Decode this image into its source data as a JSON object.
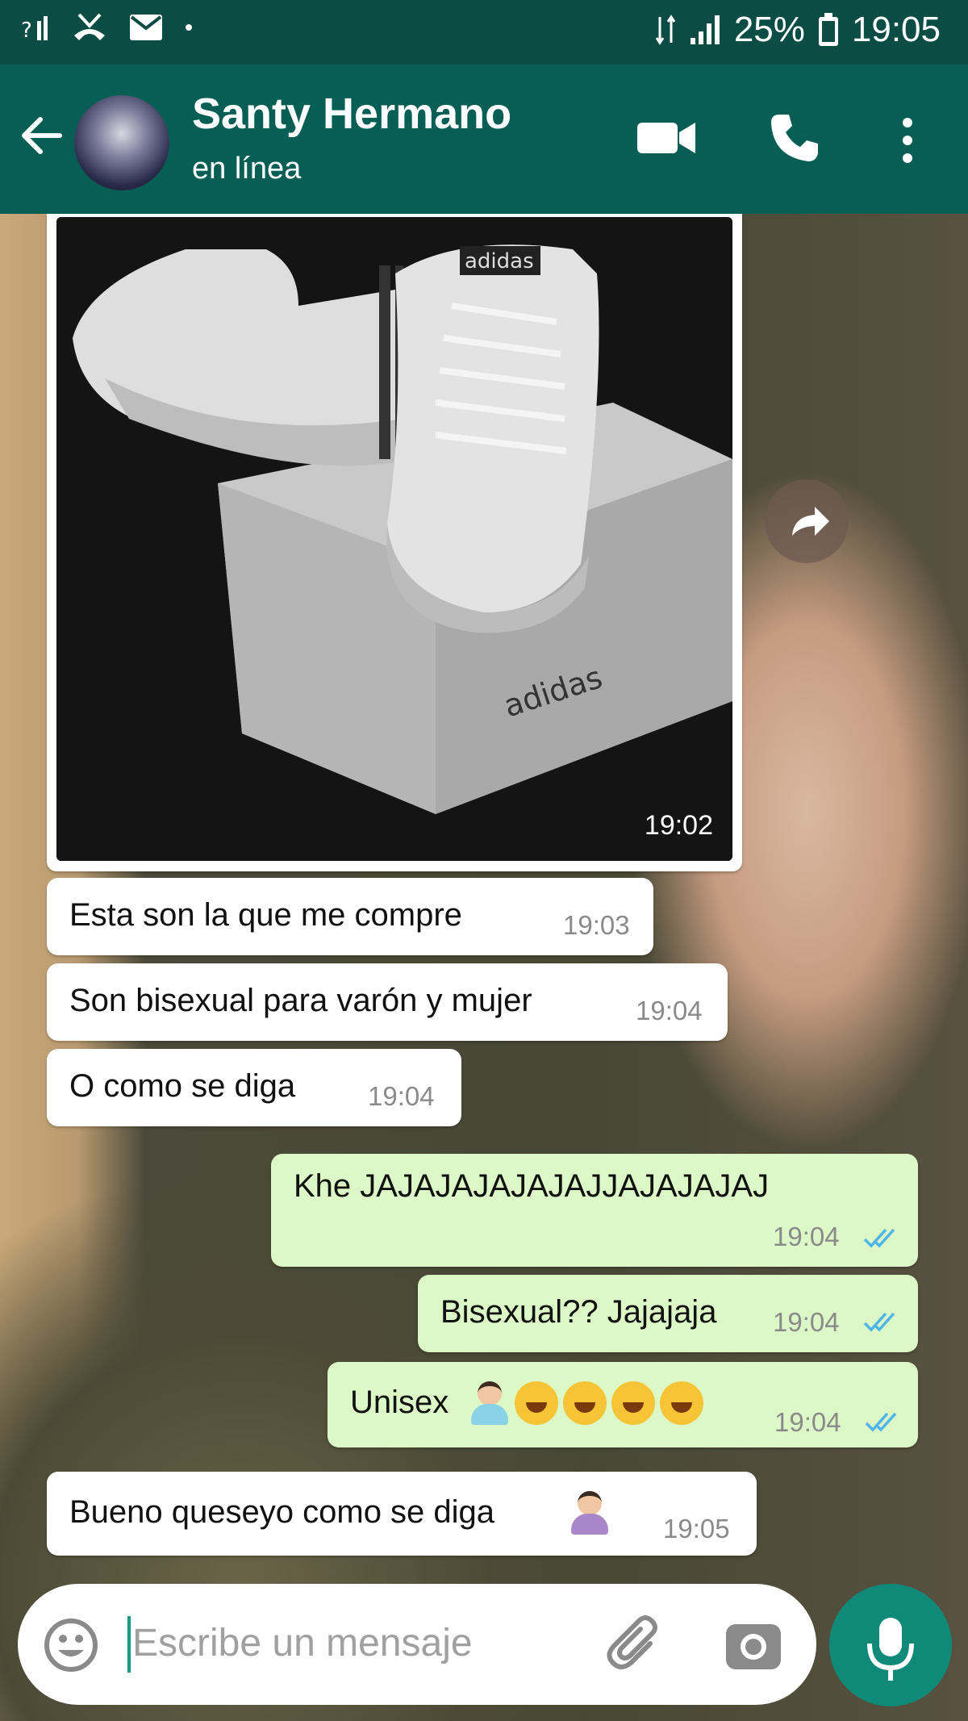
{
  "status_bar": {
    "battery": "25%",
    "time": "19:05"
  },
  "header": {
    "contact_name": "Santy Hermano",
    "status": "en línea"
  },
  "image_message": {
    "time": "19:02",
    "box_text": "adidas",
    "shoe_text": "adidas"
  },
  "messages": [
    {
      "text": "Esta son la que me compre",
      "time": "19:03"
    },
    {
      "text": "Son bisexual para varón y mujer",
      "time": "19:04"
    },
    {
      "text": "O como se diga",
      "time": "19:04"
    },
    {
      "text": "Khe JAJAJAJAJAJAJJAJAJAJAJ",
      "time": "19:04"
    },
    {
      "text": "Bisexual?? Jajajaja",
      "time": "19:04"
    },
    {
      "text": "Unisex",
      "time": "19:04"
    },
    {
      "text": "Bueno queseyo como se diga",
      "time": "19:05"
    }
  ],
  "composer": {
    "placeholder": "Escribe un mensaje"
  },
  "colors": {
    "header": "#075e54",
    "status_bar": "#0b4d44",
    "outgoing": "#dcf8c6",
    "incoming": "#ffffff",
    "tick_blue": "#4fb6ec",
    "mic": "#0f8a78"
  }
}
